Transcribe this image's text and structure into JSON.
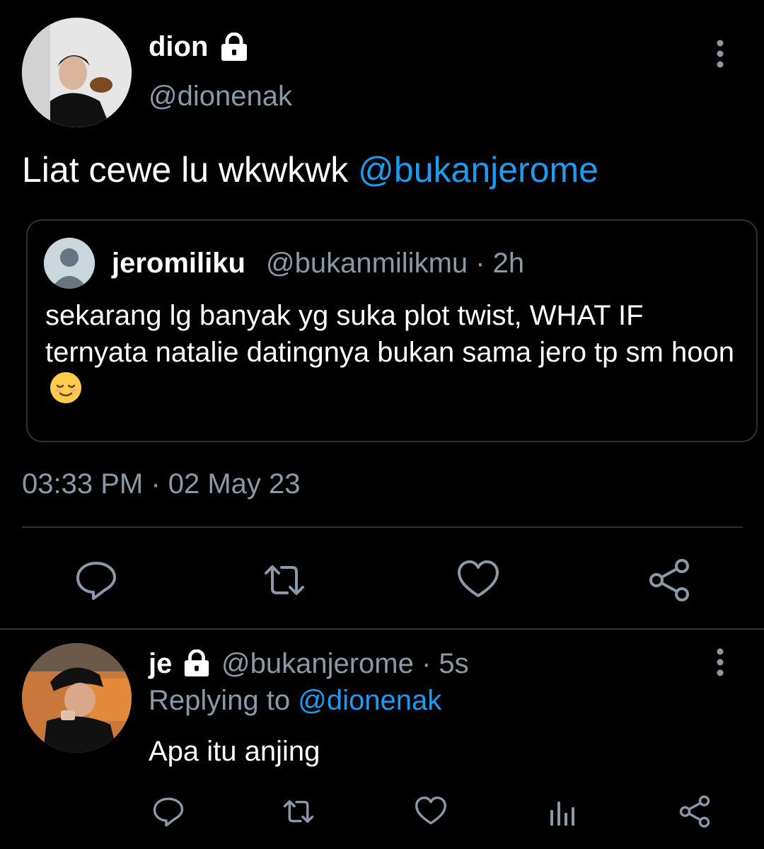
{
  "tweet": {
    "author_name": "dion",
    "author_handle": "@dionenak",
    "text": "Liat cewe lu wkwkwk ",
    "mention": "@bukanjerome",
    "timestamp": "03:33 PM · 02 May 23",
    "quote": {
      "author_name": "jeromiliku",
      "author_handle": "@bukanmilikmu · 2h",
      "text": "sekarang lg banyak yg suka plot twist, WHAT IF ternyata natalie datingnya bukan sama jero tp sm hoon",
      "emoji": "relieved-face"
    },
    "actions": [
      "reply-icon",
      "retweet-icon",
      "like-icon",
      "share-icon"
    ]
  },
  "reply": {
    "author_name": "je",
    "author_handle": "@bukanjerome · 5s",
    "replying_label": "Replying to ",
    "replying_to": "@dionenak",
    "text": "Apa itu anjing",
    "actions": [
      "reply-icon",
      "retweet-icon",
      "like-icon",
      "analytics-icon",
      "share-icon"
    ]
  },
  "colors": {
    "background": "#000000",
    "text": "#ffffff",
    "muted": "#8b98a5",
    "link": "#1d9bf0",
    "border": "#2f3336"
  }
}
